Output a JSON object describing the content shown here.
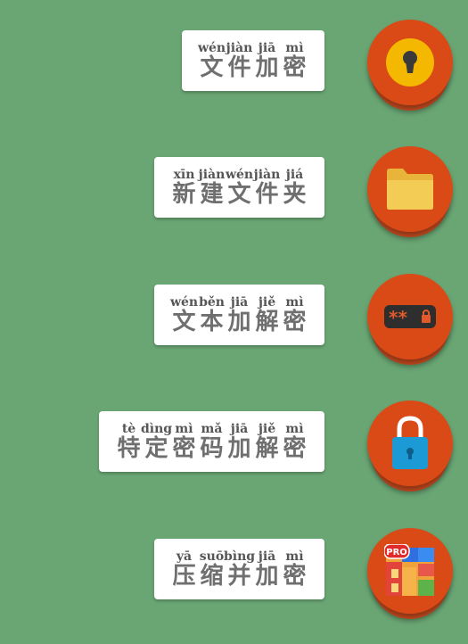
{
  "colors": {
    "background": "#6aa674",
    "fab": "#da4a17",
    "card": "#ffffff"
  },
  "menu": [
    {
      "icon": "keyhole-lock-icon",
      "syllables": [
        {
          "py": "wén",
          "hz": "文"
        },
        {
          "py": "jiàn",
          "hz": "件"
        },
        {
          "py": "jiā",
          "hz": "加"
        },
        {
          "py": "mì",
          "hz": "密"
        }
      ]
    },
    {
      "icon": "folder-icon",
      "syllables": [
        {
          "py": "xīn",
          "hz": "新"
        },
        {
          "py": "jiàn",
          "hz": "建"
        },
        {
          "py": "wén",
          "hz": "文"
        },
        {
          "py": "jiàn",
          "hz": "件"
        },
        {
          "py": "jiá",
          "hz": "夹"
        }
      ]
    },
    {
      "icon": "password-field-icon",
      "password_mask": "**",
      "syllables": [
        {
          "py": "wén",
          "hz": "文"
        },
        {
          "py": "běn",
          "hz": "本"
        },
        {
          "py": "jiā",
          "hz": "加"
        },
        {
          "py": "jiě",
          "hz": "解"
        },
        {
          "py": "mì",
          "hz": "密"
        }
      ]
    },
    {
      "icon": "padlock-icon",
      "syllables": [
        {
          "py": "tè",
          "hz": "特"
        },
        {
          "py": "dìng",
          "hz": "定"
        },
        {
          "py": "mì",
          "hz": "密"
        },
        {
          "py": "mǎ",
          "hz": "码"
        },
        {
          "py": "jiā",
          "hz": "加"
        },
        {
          "py": "jiě",
          "hz": "解"
        },
        {
          "py": "mì",
          "hz": "密"
        }
      ]
    },
    {
      "icon": "pro-apps-icon",
      "badge": "PRO",
      "syllables": [
        {
          "py": "yā",
          "hz": "压"
        },
        {
          "py": "suō",
          "hz": "缩"
        },
        {
          "py": "bìng",
          "hz": "并"
        },
        {
          "py": "jiā",
          "hz": "加"
        },
        {
          "py": "mì",
          "hz": "密"
        }
      ]
    }
  ]
}
